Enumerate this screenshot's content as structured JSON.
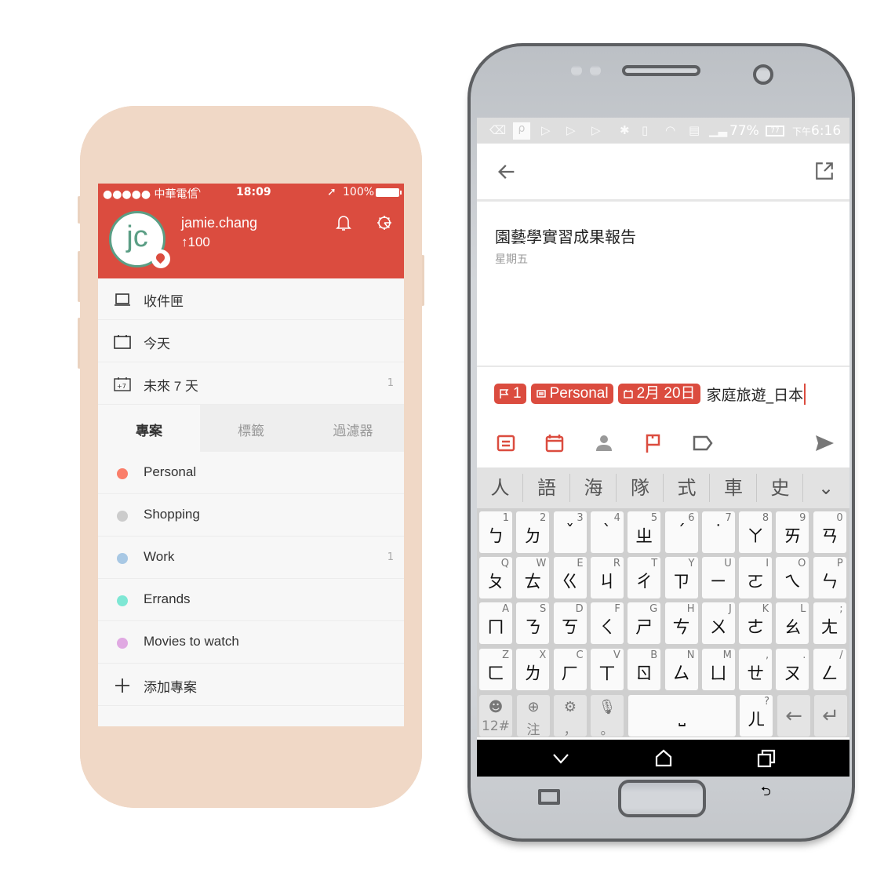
{
  "iphone": {
    "status": {
      "carrier": "●●●●● 中華電信",
      "time": "18:09",
      "battery": "100%"
    },
    "profile": {
      "avatar_initials": "jc",
      "username": "jamie.chang",
      "karma": "↑100"
    },
    "header_icons": [
      "bell-icon",
      "gear-icon"
    ],
    "nav": [
      {
        "icon": "inbox-icon",
        "label": "收件匣",
        "count": ""
      },
      {
        "icon": "calendar-today-icon",
        "label": "今天",
        "count": ""
      },
      {
        "icon": "calendar-plus7-icon",
        "label": "未來 7 天",
        "count": "1"
      }
    ],
    "tabs": [
      {
        "label": "專案",
        "active": true
      },
      {
        "label": "標籤",
        "active": false
      },
      {
        "label": "過濾器",
        "active": false
      }
    ],
    "projects": [
      {
        "label": "Personal",
        "color": "#fa7e6a",
        "count": ""
      },
      {
        "label": "Shopping",
        "color": "#cccccc",
        "count": ""
      },
      {
        "label": "Work",
        "color": "#a8c8e4",
        "count": "1"
      },
      {
        "label": "Errands",
        "color": "#7ee7d4",
        "count": ""
      },
      {
        "label": "Movies to watch",
        "color": "#e0a9e2",
        "count": ""
      }
    ],
    "add_project": "添加專案"
  },
  "android": {
    "status": {
      "battery_pct": "77%",
      "battery_icon_text": "77",
      "clock_prefix": "下午",
      "clock": "6:16"
    },
    "task": {
      "title": "園藝學實習成果報告",
      "date": "星期五"
    },
    "quick_add": {
      "chips": [
        {
          "icon": "flag-icon",
          "label": "1"
        },
        {
          "icon": "project-icon",
          "label": "Personal"
        },
        {
          "icon": "calendar-icon",
          "label": "2月 20日"
        }
      ],
      "typed_text": "家庭旅遊_日本"
    },
    "keyboard": {
      "candidates": [
        "人",
        "語",
        "海",
        "隊",
        "式",
        "車",
        "史"
      ],
      "rows": [
        [
          [
            "ㄅ",
            "1"
          ],
          [
            "ㄉ",
            "2"
          ],
          [
            "ˇ",
            "3"
          ],
          [
            "ˋ",
            "4"
          ],
          [
            "ㄓ",
            "5"
          ],
          [
            "ˊ",
            "6"
          ],
          [
            "˙",
            "7"
          ],
          [
            "ㄚ",
            "8"
          ],
          [
            "ㄞ",
            "9"
          ],
          [
            "ㄢ",
            "0"
          ]
        ],
        [
          [
            "ㄆ",
            "Q"
          ],
          [
            "ㄊ",
            "W"
          ],
          [
            "ㄍ",
            "E"
          ],
          [
            "ㄐ",
            "R"
          ],
          [
            "ㄔ",
            "T"
          ],
          [
            "ㄗ",
            "Y"
          ],
          [
            "ㄧ",
            "U"
          ],
          [
            "ㄛ",
            "I"
          ],
          [
            "ㄟ",
            "O"
          ],
          [
            "ㄣ",
            "P"
          ]
        ],
        [
          [
            "ㄇ",
            "A"
          ],
          [
            "ㄋ",
            "S"
          ],
          [
            "ㄎ",
            "D"
          ],
          [
            "ㄑ",
            "F"
          ],
          [
            "ㄕ",
            "G"
          ],
          [
            "ㄘ",
            "H"
          ],
          [
            "ㄨ",
            "J"
          ],
          [
            "ㄜ",
            "K"
          ],
          [
            "ㄠ",
            "L"
          ],
          [
            "ㄤ",
            ";"
          ]
        ],
        [
          [
            "ㄈ",
            "Z"
          ],
          [
            "ㄌ",
            "X"
          ],
          [
            "ㄏ",
            "C"
          ],
          [
            "ㄒ",
            "V"
          ],
          [
            "ㄖ",
            "B"
          ],
          [
            "ㄙ",
            "N"
          ],
          [
            "ㄩ",
            "M"
          ],
          [
            "ㄝ",
            ","
          ],
          [
            "ㄡ",
            "."
          ],
          [
            "ㄥ",
            "/"
          ]
        ]
      ],
      "bottom": {
        "emoji_sub": "12#",
        "lang_sub": "注",
        "settings_sub": "，",
        "mic_sub": "。",
        "space": "⎵",
        "er_main": "ㄦ",
        "er_sub": "?"
      }
    }
  }
}
